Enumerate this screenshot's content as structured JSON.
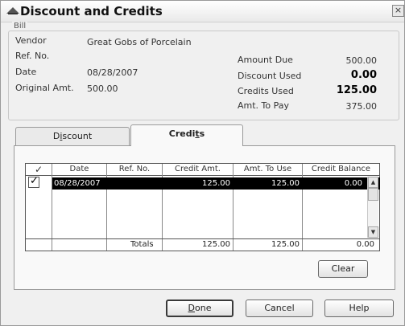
{
  "window": {
    "title": "Discount and Credits",
    "close_glyph": "×"
  },
  "bill": {
    "legend": "Bill",
    "vendor_label": "Vendor",
    "vendor_value": "Great Gobs of Porcelain",
    "ref_label": "Ref. No.",
    "ref_value": "",
    "date_label": "Date",
    "date_value": "08/28/2007",
    "orig_label": "Original Amt.",
    "orig_value": "500.00",
    "amount_due_label": "Amount Due",
    "amount_due_value": "500.00",
    "discount_used_label": "Discount Used",
    "discount_used_value": "0.00",
    "credits_used_label": "Credits Used",
    "credits_used_value": "125.00",
    "amt_to_pay_label": "Amt. To Pay",
    "amt_to_pay_value": "375.00"
  },
  "tabs": {
    "discount_pre": "D",
    "discount_u": "i",
    "discount_post": "scount",
    "credits_pre": "Credi",
    "credits_u": "t",
    "credits_post": "s",
    "active": "Credits"
  },
  "grid": {
    "check_header": "✓",
    "headers": [
      "Date",
      "Ref. No.",
      "Credit Amt.",
      "Amt. To Use",
      "Credit Balance"
    ],
    "rows": [
      {
        "checked": "✓",
        "date": "08/28/2007",
        "ref": "",
        "credit_amt": "125.00",
        "amt_to_use": "125.00",
        "credit_balance": "0.00"
      }
    ],
    "totals_label": "Totals",
    "total_credit_amt": "125.00",
    "total_amt_to_use": "125.00",
    "total_credit_balance": "0.00"
  },
  "buttons": {
    "clear": "Clear",
    "done_u": "D",
    "done_rest": "one",
    "cancel": "Cancel",
    "help": "Help"
  }
}
